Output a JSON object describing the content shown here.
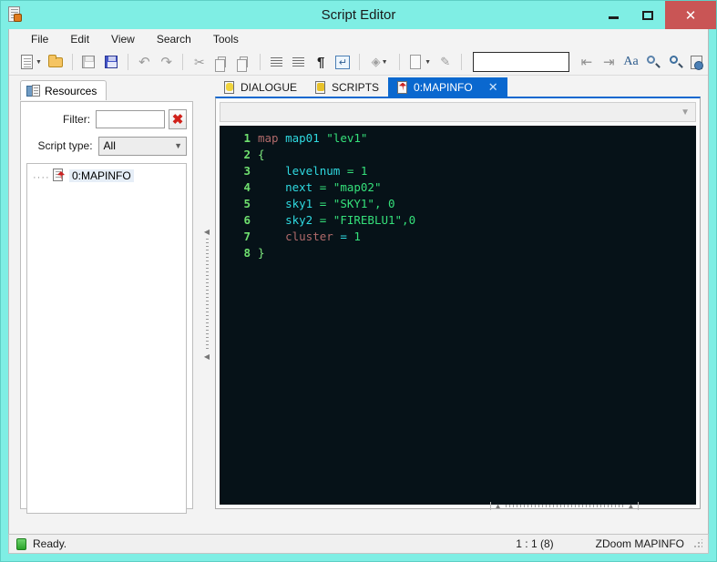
{
  "window": {
    "title": "Script Editor",
    "icon": "script-document-icon",
    "minimize_label": "–",
    "maximize_label": "□",
    "close_label": "✕",
    "titlebar_color": "#7feee4",
    "close_color": "#c95555"
  },
  "menu": {
    "items": [
      {
        "label": "File"
      },
      {
        "label": "Edit"
      },
      {
        "label": "View"
      },
      {
        "label": "Search"
      },
      {
        "label": "Tools"
      }
    ]
  },
  "toolbar": {
    "buttons": [
      {
        "name": "new-file-button",
        "icon": "new-document-icon",
        "has_caret": true
      },
      {
        "name": "open-file-button",
        "icon": "open-folder-icon",
        "has_caret": false
      },
      {
        "name": "save-button",
        "icon": "save-disk-icon",
        "has_caret": false
      },
      {
        "name": "save-all-button",
        "icon": "save-all-disks-icon",
        "has_caret": false
      },
      {
        "name": "undo-button",
        "icon": "undo-arrow-icon",
        "has_caret": false
      },
      {
        "name": "redo-button",
        "icon": "redo-arrow-icon",
        "has_caret": false
      },
      {
        "name": "cut-button",
        "icon": "scissors-icon",
        "has_caret": false
      },
      {
        "name": "copy-button",
        "icon": "copy-pages-icon",
        "has_caret": false
      },
      {
        "name": "paste-button",
        "icon": "clipboard-paste-icon",
        "has_caret": false
      },
      {
        "name": "unindent-button",
        "icon": "decrease-indent-icon",
        "has_caret": false
      },
      {
        "name": "indent-button",
        "icon": "increase-indent-icon",
        "has_caret": false
      },
      {
        "name": "show-whitespace-button",
        "icon": "pilcrow-icon",
        "has_caret": false
      },
      {
        "name": "wrap-lines-button",
        "icon": "enter-return-icon",
        "has_caret": false
      },
      {
        "name": "compile-button",
        "icon": "puzzle-piece-icon",
        "has_caret": true
      },
      {
        "name": "export-button",
        "icon": "document-export-icon",
        "has_caret": true
      },
      {
        "name": "edit-properties-button",
        "icon": "pencil-page-icon",
        "has_caret": false
      },
      {
        "name": "find-back-button",
        "icon": "arrow-left-bar-icon",
        "has_caret": false
      },
      {
        "name": "find-forward-button",
        "icon": "arrow-right-bar-icon",
        "has_caret": false
      },
      {
        "name": "font-size-button",
        "icon": "font-aa-icon",
        "has_caret": false
      },
      {
        "name": "find-replace-button",
        "icon": "magnifier-lines-icon",
        "has_caret": false
      },
      {
        "name": "zoom-button",
        "icon": "magnifier-icon",
        "has_caret": false
      },
      {
        "name": "reference-button",
        "icon": "reference-book-icon",
        "has_caret": false
      }
    ],
    "search": {
      "value": "",
      "placeholder": ""
    }
  },
  "sidebar": {
    "tab_label": "Resources",
    "tab_icon": "resources-icon",
    "filter": {
      "label": "Filter:",
      "value": "",
      "placeholder": "",
      "clear_button": "✖",
      "clear_name": "clear-filter-button"
    },
    "script_type": {
      "label": "Script type:",
      "selected": "All",
      "options": [
        "All"
      ]
    },
    "tree": {
      "items": [
        {
          "label": "0:MAPINFO",
          "icon": "mapinfo-file-icon",
          "selected": true
        }
      ]
    }
  },
  "editor": {
    "tabs": [
      {
        "label": "DIALOGUE",
        "icon": "dialogue-file-icon",
        "active": false,
        "closable": false
      },
      {
        "label": "SCRIPTS",
        "icon": "scripts-file-icon",
        "active": false,
        "closable": false
      },
      {
        "label": "0:MAPINFO",
        "icon": "mapinfo-file-icon",
        "active": true,
        "closable": true,
        "close_label": "✕"
      }
    ],
    "navigation_combo": {
      "selected": "",
      "chevron": "❯"
    },
    "background_color": "#061218",
    "lines": [
      {
        "number": "1",
        "text": "map map01 \"lev1\"",
        "tokens": [
          {
            "t": "map",
            "c": "tk-kw"
          },
          {
            "t": " ",
            "c": "tk-op"
          },
          {
            "t": "map01",
            "c": "tk-id"
          },
          {
            "t": " ",
            "c": "tk-op"
          },
          {
            "t": "\"lev1\"",
            "c": "tk-str"
          }
        ]
      },
      {
        "number": "2",
        "text": "{",
        "tokens": [
          {
            "t": "{",
            "c": "tk-punc"
          }
        ]
      },
      {
        "number": "3",
        "text": "    levelnum = 1",
        "tokens": [
          {
            "t": "    ",
            "c": "tk-op"
          },
          {
            "t": "levelnum",
            "c": "tk-id"
          },
          {
            "t": " = ",
            "c": "tk-op"
          },
          {
            "t": "1",
            "c": "tk-num"
          }
        ]
      },
      {
        "number": "4",
        "text": "    next = \"map02\"",
        "tokens": [
          {
            "t": "    ",
            "c": "tk-op"
          },
          {
            "t": "next",
            "c": "tk-id"
          },
          {
            "t": " = ",
            "c": "tk-op"
          },
          {
            "t": "\"map02\"",
            "c": "tk-str"
          }
        ]
      },
      {
        "number": "5",
        "text": "    sky1 = \"SKY1\", 0",
        "tokens": [
          {
            "t": "    ",
            "c": "tk-op"
          },
          {
            "t": "sky1",
            "c": "tk-id"
          },
          {
            "t": " = ",
            "c": "tk-op"
          },
          {
            "t": "\"SKY1\", 0",
            "c": "tk-str"
          }
        ]
      },
      {
        "number": "6",
        "text": "    sky2 = \"FIREBLU1\",0",
        "tokens": [
          {
            "t": "    ",
            "c": "tk-op"
          },
          {
            "t": "sky2",
            "c": "tk-id"
          },
          {
            "t": " = ",
            "c": "tk-op"
          },
          {
            "t": "\"FIREBLU1\",0",
            "c": "tk-str"
          }
        ]
      },
      {
        "number": "7",
        "text": "    cluster = 1",
        "tokens": [
          {
            "t": "    ",
            "c": "tk-op"
          },
          {
            "t": "cluster",
            "c": "tk-kw"
          },
          {
            "t": " = ",
            "c": "tk-op2"
          },
          {
            "t": "1",
            "c": "tk-num"
          }
        ]
      },
      {
        "number": "8",
        "text": "}",
        "tokens": [
          {
            "t": "}",
            "c": "tk-punc"
          }
        ]
      }
    ]
  },
  "statusbar": {
    "led": "ready-indicator",
    "message": "Ready.",
    "position": "1 : 1 (8)",
    "language": "ZDoom MAPINFO"
  }
}
